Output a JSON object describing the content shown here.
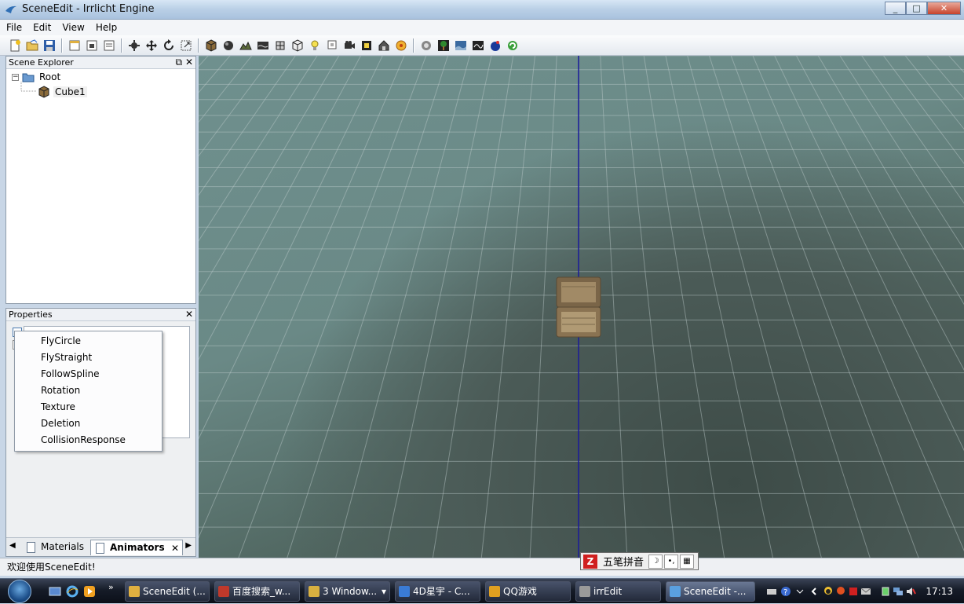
{
  "window": {
    "title": "SceneEdit - Irrlicht Engine",
    "buttons": [
      "_",
      "□",
      "✕"
    ]
  },
  "menu": [
    "File",
    "Edit",
    "View",
    "Help"
  ],
  "toolbar": {
    "groups": [
      [
        "new-scene-icon",
        "open-icon",
        "save-icon"
      ],
      [
        "import-icon",
        "export-icon",
        "options-icon"
      ],
      [
        "select-icon",
        "move-icon",
        "rotate-icon",
        "scale-icon"
      ],
      [
        "cube-node-icon",
        "sphere-node-icon",
        "terrain-icon",
        "water-icon",
        "mesh-icon",
        "octree-icon",
        "light-icon",
        "billboard-icon",
        "camera-icon",
        "skybox-icon",
        "house-icon",
        "particle-icon"
      ],
      [
        "settings-icon",
        "tree-icon",
        "image-icon",
        "animation-icon",
        "globe-icon",
        "recycle-icon"
      ]
    ]
  },
  "scene_explorer": {
    "title": "Scene Explorer",
    "tree": [
      {
        "label": "Root",
        "icon": "folder-icon",
        "expanded": true
      },
      {
        "label": "Cube1",
        "icon": "cube-icon"
      }
    ]
  },
  "properties": {
    "title": "Properties",
    "tabs": [
      {
        "label": "Materials",
        "active": false
      },
      {
        "label": "Animators",
        "active": true
      }
    ]
  },
  "context_menu": {
    "items": [
      "FlyCircle",
      "FlyStraight",
      "FollowSpline",
      "Rotation",
      "Texture",
      "Deletion",
      "CollisionResponse"
    ]
  },
  "status_bar": {
    "text": "欢迎使用SceneEdit!"
  },
  "ime": {
    "label": "五笔拼音"
  },
  "taskbar": {
    "buttons": [
      {
        "label": "SceneEdit (...",
        "color": "#e0b040"
      },
      {
        "label": "百度搜索_w...",
        "color": "#c0392b"
      },
      {
        "label": "3 Window...",
        "color": "#d8b040"
      },
      {
        "label": "4D星宇 - C...",
        "color": "#3a7bd5"
      },
      {
        "label": "QQ游戏",
        "color": "#e0a020"
      },
      {
        "label": "irrEdit",
        "color": "#9a9a9a"
      },
      {
        "label": "SceneEdit -...",
        "color": "#5aa0e0",
        "active": true
      }
    ],
    "clock": "17:13"
  }
}
